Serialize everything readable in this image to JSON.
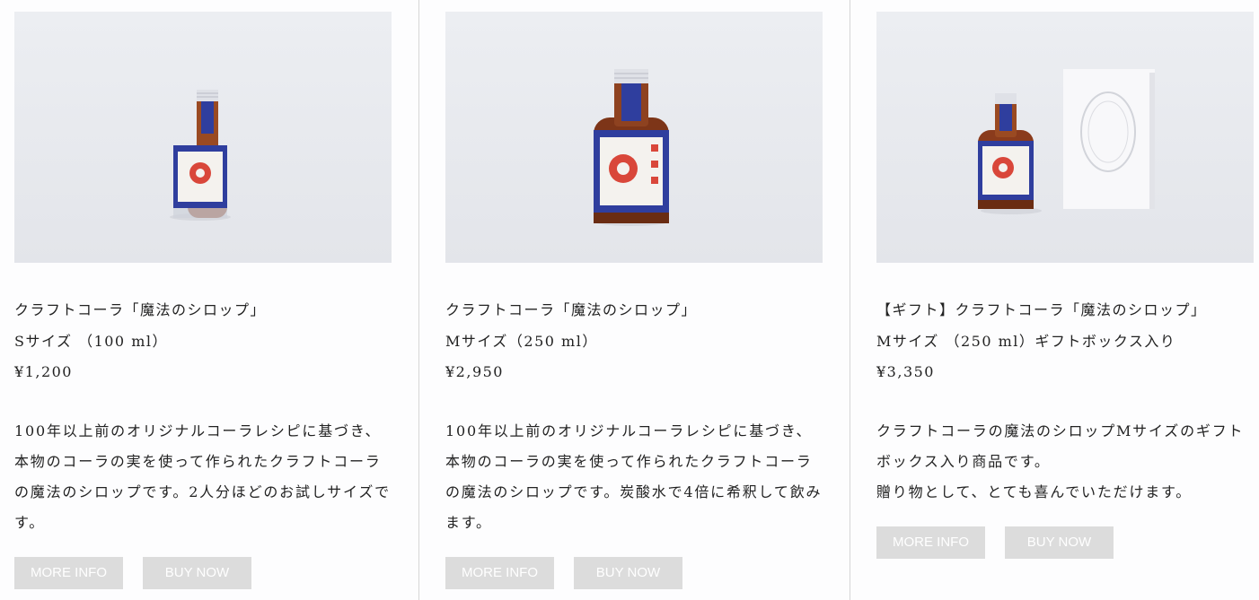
{
  "products": [
    {
      "title_line1": "クラフトコーラ「魔法のシロップ」",
      "title_line2": "Sサイズ （100 ml）",
      "price": "¥1,200",
      "description": "100年以上前のオリジナルコーラレシピに基づき、本物のコーラの実を使って作られたクラフトコーラの魔法のシロップです。2人分ほどのお試しサイズです。",
      "more_info_label": "MORE INFO",
      "buy_now_label": "BUY NOW",
      "image_alt": "IYOSHI COLA bottle small"
    },
    {
      "title_line1": "クラフトコーラ「魔法のシロップ」",
      "title_line2": "Mサイズ（250 ml）",
      "price": "¥2,950",
      "description": "100年以上前のオリジナルコーラレシピに基づき、本物のコーラの実を使って作られたクラフトコーラの魔法のシロップです。炭酸水で4倍に希釈して飲みます。",
      "more_info_label": "MORE INFO",
      "buy_now_label": "BUY NOW",
      "image_alt": "IYOSHI COLA bottle medium"
    },
    {
      "title_line1": "【ギフト】クラフトコーラ「魔法のシロップ」",
      "title_line2": "Mサイズ （250 ml）ギフトボックス入り",
      "price": "¥3,350",
      "description": "クラフトコーラの魔法のシロップMサイズのギフトボックス入り商品です。\n贈り物として、とても喜んでいただけます。",
      "more_info_label": "MORE INFO",
      "buy_now_label": "BUY NOW",
      "image_alt": "IYOSHI COLA bottle with gift box"
    }
  ],
  "colors": {
    "button_bg": "#dcdcdc",
    "button_text": "#ffffff",
    "label_blue": "#2f3e9e",
    "label_red": "#d9473a",
    "syrup": "#8a3b1c"
  }
}
